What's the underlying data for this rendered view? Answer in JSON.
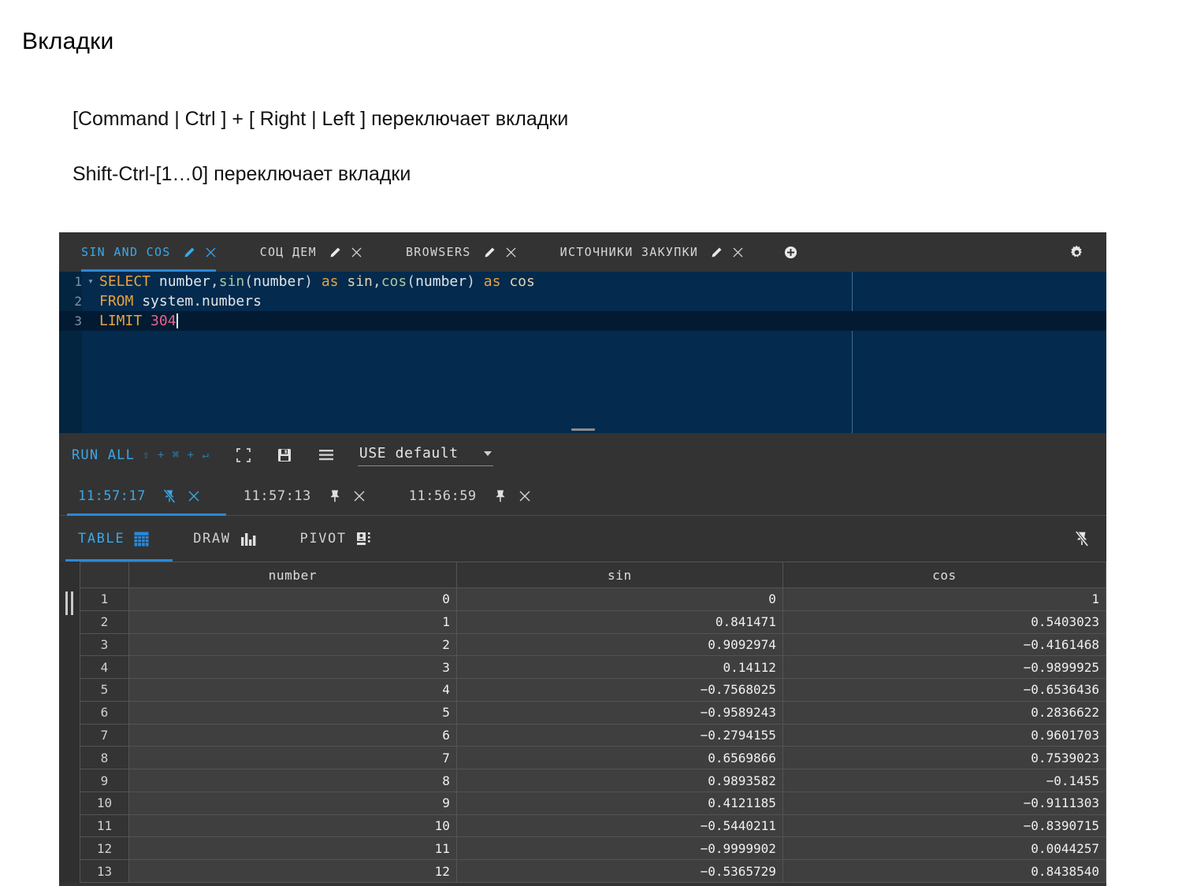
{
  "slide": {
    "title": "Вкладки",
    "bullets": [
      "[Command | Ctrl ] + [ Right | Left ] переключает вкладки",
      "Shift-Ctrl-[1…0] переключает вкладки"
    ]
  },
  "app": {
    "tabs": [
      {
        "label": "SIN AND COS",
        "active": true,
        "edit_icon": "pencil-icon",
        "close_icon": "close-icon"
      },
      {
        "label": "СОЦ ДЕМ",
        "active": false,
        "edit_icon": "pencil-icon",
        "close_icon": "close-icon"
      },
      {
        "label": "BROWSERS",
        "active": false,
        "edit_icon": "pencil-icon",
        "close_icon": "close-icon"
      },
      {
        "label": "ИСТОЧНИКИ ЗАКУПКИ",
        "active": false,
        "edit_icon": "pencil-icon",
        "close_icon": "close-icon"
      }
    ],
    "add_tab_icon": "plus-circle-icon",
    "settings_icon": "gear-icon",
    "editor": {
      "lines": [
        {
          "number": "1",
          "fold": "▾",
          "tokens": [
            {
              "t": "SELECT",
              "c": "kw"
            },
            {
              "t": " ",
              "c": "id"
            },
            {
              "t": "number",
              "c": "id"
            },
            {
              "t": ",",
              "c": "punct"
            },
            {
              "t": "sin",
              "c": "fn"
            },
            {
              "t": "(",
              "c": "punct"
            },
            {
              "t": "number",
              "c": "id"
            },
            {
              "t": ")",
              "c": "punct"
            },
            {
              "t": " ",
              "c": "id"
            },
            {
              "t": "as",
              "c": "kw"
            },
            {
              "t": " ",
              "c": "id"
            },
            {
              "t": "sin",
              "c": "tan"
            },
            {
              "t": ",",
              "c": "punct"
            },
            {
              "t": "cos",
              "c": "fn"
            },
            {
              "t": "(",
              "c": "punct"
            },
            {
              "t": "number",
              "c": "id"
            },
            {
              "t": ")",
              "c": "punct"
            },
            {
              "t": " ",
              "c": "id"
            },
            {
              "t": "as",
              "c": "kw"
            },
            {
              "t": " ",
              "c": "id"
            },
            {
              "t": "cos",
              "c": "tan"
            }
          ]
        },
        {
          "number": "2",
          "fold": "",
          "tokens": [
            {
              "t": "FROM",
              "c": "kw"
            },
            {
              "t": " ",
              "c": "id"
            },
            {
              "t": "system.numbers",
              "c": "id"
            }
          ]
        },
        {
          "number": "3",
          "fold": "",
          "current": true,
          "caret": true,
          "tokens": [
            {
              "t": "LIMIT",
              "c": "kw"
            },
            {
              "t": " ",
              "c": "id"
            },
            {
              "t": "304",
              "c": "num"
            }
          ]
        }
      ]
    },
    "toolbar": {
      "run_all_label": "RUN ALL",
      "run_all_shortcut": "⇧ + ⌘ + ↵",
      "fullscreen_icon": "fullscreen-icon",
      "save_icon": "save-icon",
      "menu_icon": "menu-icon",
      "database_label": "USE default",
      "database_caret_icon": "chevron-down-icon"
    },
    "result_tabs": [
      {
        "time": "11:57:17",
        "active": true,
        "pin_icon": "pin-off-icon",
        "close_icon": "close-icon"
      },
      {
        "time": "11:57:13",
        "active": false,
        "pin_icon": "pin-icon",
        "close_icon": "close-icon"
      },
      {
        "time": "11:56:59",
        "active": false,
        "pin_icon": "pin-icon",
        "close_icon": "close-icon"
      }
    ],
    "view_tabs": [
      {
        "label": "TABLE",
        "active": true,
        "icon": "table-grid-icon"
      },
      {
        "label": "DRAW",
        "active": false,
        "icon": "bar-chart-icon"
      },
      {
        "label": "PIVOT",
        "active": false,
        "icon": "pivot-icon"
      }
    ],
    "view_pin_icon": "pin-off-icon",
    "table": {
      "columns": [
        "",
        "number",
        "sin",
        "cos"
      ],
      "rows": [
        {
          "n": "1",
          "number": "0",
          "sin": "0",
          "cos": "1"
        },
        {
          "n": "2",
          "number": "1",
          "sin": "0.841471",
          "cos": "0.5403023"
        },
        {
          "n": "3",
          "number": "2",
          "sin": "0.9092974",
          "cos": "−0.4161468"
        },
        {
          "n": "4",
          "number": "3",
          "sin": "0.14112",
          "cos": "−0.9899925"
        },
        {
          "n": "5",
          "number": "4",
          "sin": "−0.7568025",
          "cos": "−0.6536436"
        },
        {
          "n": "6",
          "number": "5",
          "sin": "−0.9589243",
          "cos": "0.2836622"
        },
        {
          "n": "7",
          "number": "6",
          "sin": "−0.2794155",
          "cos": "0.9601703"
        },
        {
          "n": "8",
          "number": "7",
          "sin": "0.6569866",
          "cos": "0.7539023"
        },
        {
          "n": "9",
          "number": "8",
          "sin": "0.9893582",
          "cos": "−0.1455"
        },
        {
          "n": "10",
          "number": "9",
          "sin": "0.4121185",
          "cos": "−0.9111303"
        },
        {
          "n": "11",
          "number": "10",
          "sin": "−0.5440211",
          "cos": "−0.8390715"
        },
        {
          "n": "12",
          "number": "11",
          "sin": "−0.9999902",
          "cos": "0.0044257"
        },
        {
          "n": "13",
          "number": "12",
          "sin": "−0.5365729",
          "cos": "0.8438540"
        }
      ]
    },
    "colors": {
      "accent_blue": "#3ba7e8",
      "editor_bg": "#042a4d",
      "chrome_bg": "#333333",
      "keyword": "#e8a33d",
      "number_literal": "#e9618a"
    }
  }
}
